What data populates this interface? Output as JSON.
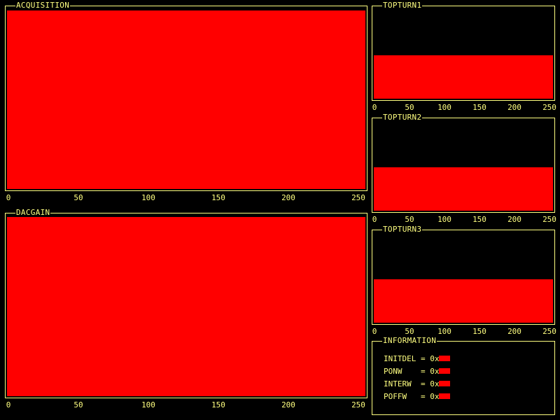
{
  "colors": {
    "background": "#000000",
    "frame": "#ffff80",
    "fill": "#ff0000"
  },
  "panels": {
    "acquisition": {
      "title": "ACQUISITION",
      "fill_level": 1.0,
      "ticks": [
        "0",
        "50",
        "100",
        "150",
        "200",
        "250"
      ]
    },
    "dacgain": {
      "title": "DACGAIN",
      "fill_level": 1.0,
      "ticks": [
        "0",
        "50",
        "100",
        "150",
        "200",
        "250"
      ]
    },
    "topturn1": {
      "title": "TOPTURN1",
      "fill_level": 0.5,
      "ticks": [
        "0",
        "50",
        "100",
        "150",
        "200",
        "250"
      ]
    },
    "topturn2": {
      "title": "TOPTURN2",
      "fill_level": 0.5,
      "ticks": [
        "0",
        "50",
        "100",
        "150",
        "200",
        "250"
      ]
    },
    "topturn3": {
      "title": "TOPTURN3",
      "fill_level": 0.5,
      "ticks": [
        "0",
        "50",
        "100",
        "150",
        "200",
        "250"
      ]
    }
  },
  "information": {
    "title": "INFORMATION",
    "rows": [
      {
        "label": "INITDEL = 0x"
      },
      {
        "label": "PONW    = 0x"
      },
      {
        "label": "INTERW  = 0x"
      },
      {
        "label": "POFFW   = 0x"
      }
    ]
  }
}
